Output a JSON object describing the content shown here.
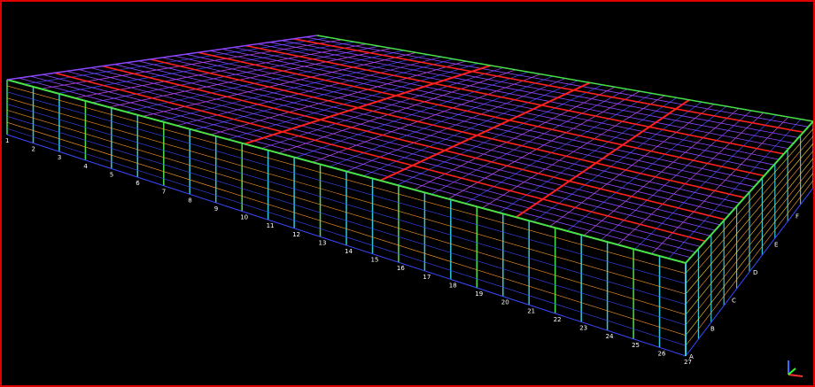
{
  "viewport": {
    "frame_color": "#e00000",
    "background": "#000000"
  },
  "colors": {
    "roof_blue": "#3a48ff",
    "roof_violet": "#8c46ff",
    "purlin_magenta": "#d24cff",
    "beam_red": "#ff2020",
    "column_cyan": "#2fc8d8",
    "bracing_green": "#47e24a",
    "girt_orange": "#ff9a2a",
    "girt_yellow": "#ffd02a"
  },
  "grid_labels": {
    "front_edge": [
      "1",
      "2",
      "3",
      "4",
      "5",
      "6",
      "7",
      "8",
      "9",
      "10",
      "11",
      "12",
      "13",
      "14",
      "15",
      "16",
      "17",
      "18",
      "19",
      "20",
      "21",
      "22",
      "23",
      "24",
      "25",
      "26",
      "27"
    ],
    "right_edge": [
      "A",
      "B",
      "C",
      "D",
      "E",
      "F",
      "G"
    ]
  },
  "axis_triad": {
    "icon": "axis-triad-icon",
    "x_color": "#ff3030",
    "y_color": "#30ff30",
    "z_color": "#3a6bff"
  }
}
